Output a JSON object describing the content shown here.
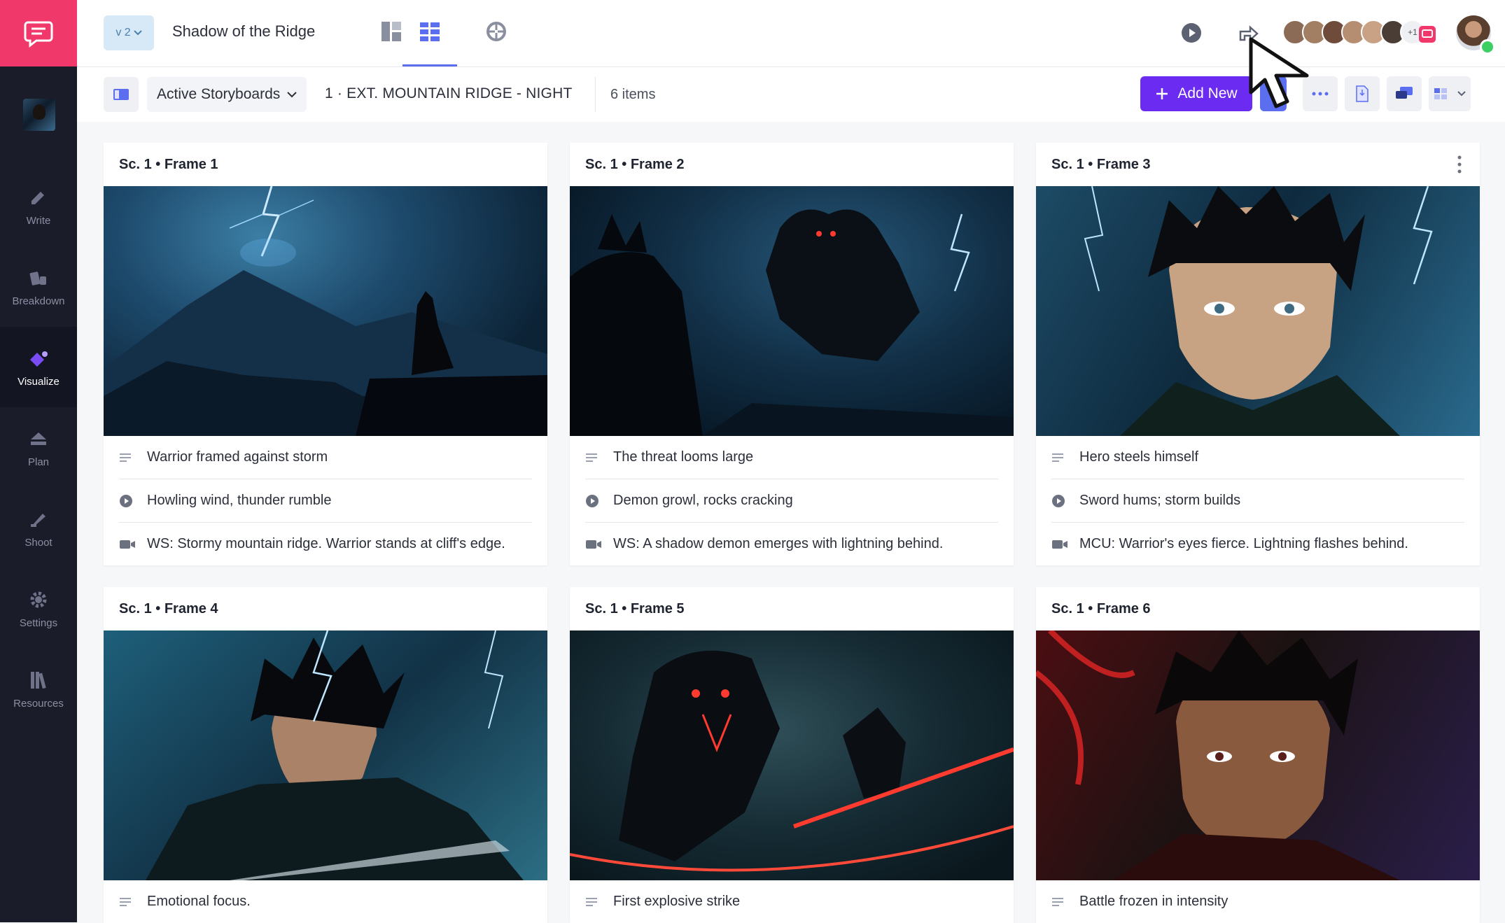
{
  "sidebar": {
    "items": [
      {
        "label": "Write",
        "icon": "pencil-icon"
      },
      {
        "label": "Breakdown",
        "icon": "breakdown-icon"
      },
      {
        "label": "Visualize",
        "icon": "visualize-icon",
        "active": true
      },
      {
        "label": "Plan",
        "icon": "plan-icon"
      },
      {
        "label": "Shoot",
        "icon": "shoot-icon"
      },
      {
        "label": "Settings",
        "icon": "gear-icon"
      },
      {
        "label": "Resources",
        "icon": "books-icon"
      }
    ]
  },
  "header": {
    "version": "v 2",
    "project_title": "Shadow of the Ridge",
    "extra_collaborators": "+1"
  },
  "toolbar": {
    "storyboard_dropdown": "Active Storyboards",
    "scene": "1 · EXT. MOUNTAIN RIDGE - NIGHT",
    "item_count": "6 items",
    "add_label": "Add New"
  },
  "colors": {
    "brand": "#f0386b",
    "accent": "#6c2bf0",
    "sidebar": "#1b1c2a"
  },
  "frames": [
    {
      "title": "Sc. 1 • Frame  1",
      "description": "Warrior framed against storm",
      "audio": "Howling wind, thunder rumble",
      "shot": "WS: Stormy mountain ridge. Warrior stands at cliff's edge."
    },
    {
      "title": "Sc. 1 • Frame  2",
      "description": "The threat looms large",
      "audio": "Demon growl, rocks cracking",
      "shot": "WS: A shadow demon emerges with lightning behind."
    },
    {
      "title": "Sc. 1 • Frame  3",
      "description": "Hero steels himself",
      "audio": "Sword hums; storm builds",
      "shot": "MCU: Warrior's eyes fierce. Lightning flashes behind."
    },
    {
      "title": "Sc. 1 • Frame  4",
      "description": "Emotional focus."
    },
    {
      "title": "Sc. 1 • Frame  5",
      "description": "First explosive strike"
    },
    {
      "title": "Sc. 1 • Frame  6",
      "description": "Battle frozen in intensity"
    }
  ]
}
